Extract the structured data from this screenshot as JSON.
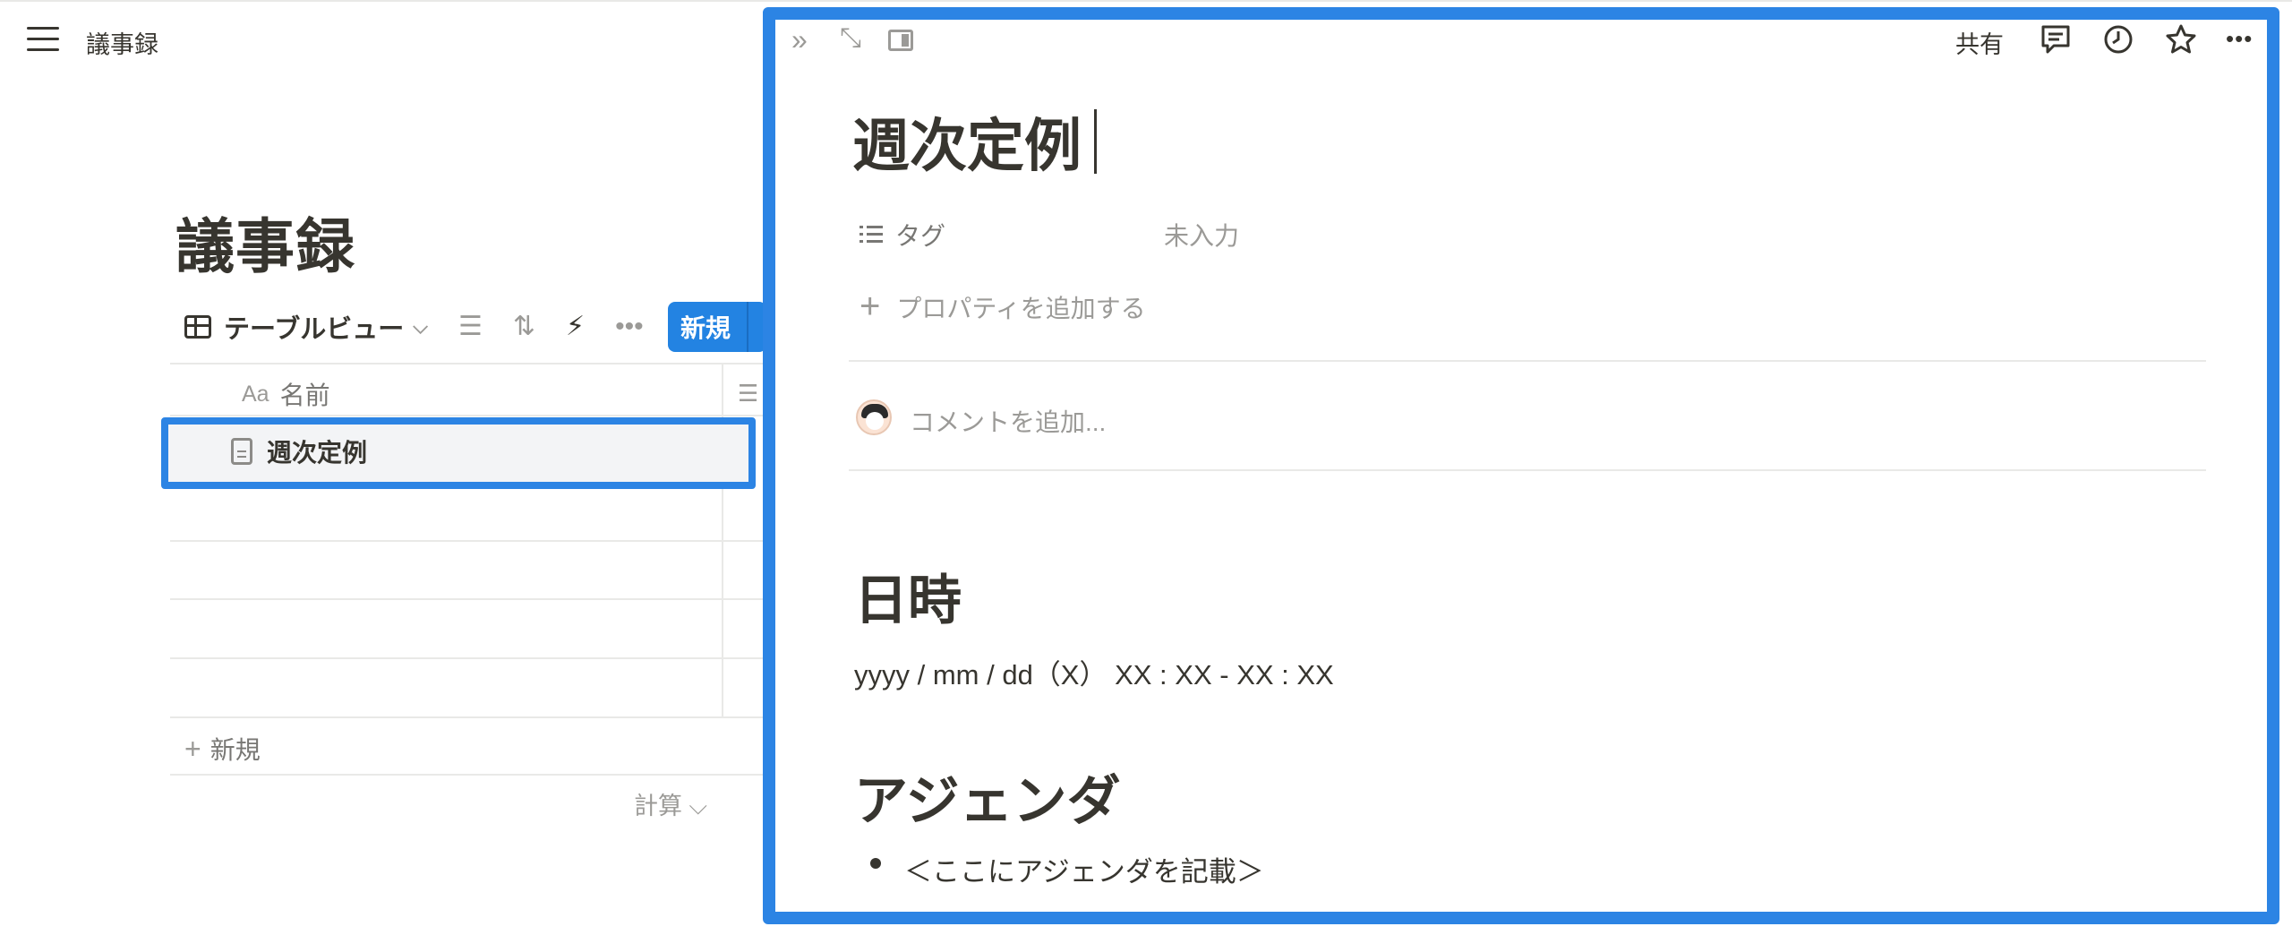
{
  "breadcrumb": {
    "title": "議事録"
  },
  "database": {
    "title": "議事録",
    "view": {
      "label": "テーブルビュー"
    },
    "new_button": {
      "label": "新規"
    },
    "columns": [
      {
        "label": "名前",
        "type_icon": "Aa"
      }
    ],
    "rows": [
      {
        "name": "週次定例",
        "icon": "page-icon"
      }
    ],
    "add_row_label": "新規",
    "calc_label": "計算"
  },
  "peek": {
    "share_label": "共有",
    "page": {
      "title": "週次定例",
      "properties": [
        {
          "name": "タグ",
          "value_placeholder": "未入力"
        }
      ],
      "add_property_label": "プロパティを追加する",
      "comment_placeholder": "コメントを追加...",
      "sections": [
        {
          "heading": "日時",
          "text": "yyyy / mm / dd（X） XX : XX - XX : XX"
        },
        {
          "heading": "アジェンダ",
          "bullets": [
            "＜ここにアジェンダを記載＞"
          ]
        }
      ]
    }
  },
  "colors": {
    "accent": "#2c84e4",
    "button": "#2383e2",
    "text": "#37352f",
    "muted": "#9b9a97"
  }
}
